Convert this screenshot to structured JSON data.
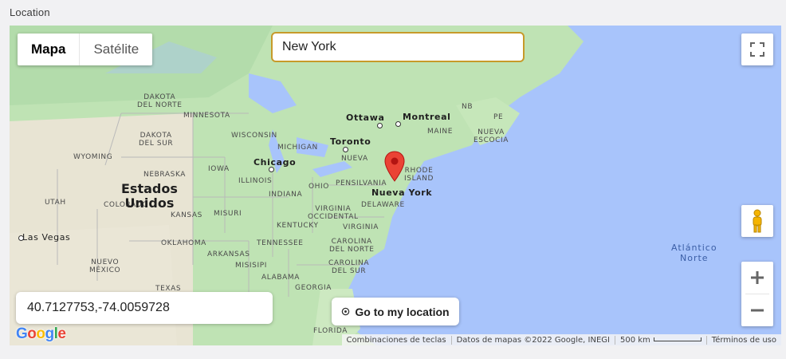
{
  "field": {
    "label": "Location"
  },
  "map_type": {
    "map_label": "Mapa",
    "satellite_label": "Satélite"
  },
  "search": {
    "value": "New York"
  },
  "coords": {
    "value": "40.7127753,-74.0059728"
  },
  "goto": {
    "label": "Go to my location",
    "icon": "location-target-icon"
  },
  "labels": {
    "dakota_norte": "DAKOTA\nDEL NORTE",
    "minnesota": "MINNESOTA",
    "wisconsin": "WISCONSIN",
    "michigan": "MICHIGAN",
    "dakota_sur": "DAKOTA\nDEL SUR",
    "wyoming": "WYOMING",
    "nebraska": "NEBRASKA",
    "iowa": "IOWA",
    "illinois": "ILLINOIS",
    "indiana": "INDIANA",
    "ohio": "OHIO",
    "pensilvania": "PENSILVANIA",
    "nueva_york_state": "NUEVA",
    "utah": "UTAH",
    "colorado": "COLORADO",
    "kansas": "KANSAS",
    "misuri": "MISURI",
    "virginia_occidental": "VIRGINIA\nOCCIDENTAL",
    "virginia": "VIRGINIA",
    "kentucky": "KENTUCKY",
    "delaware": "DELAWARE",
    "oklahoma": "OKLAHOMA",
    "tennessee": "TENNESSEE",
    "carolina_norte": "CAROLINA\nDEL NORTE",
    "carolina_sur": "CAROLINA\nDEL SUR",
    "arkansas": "ARKANSAS",
    "misisipi": "MISISIPI",
    "alabama": "ALABAMA",
    "georgia": "GEORGIA",
    "nuevo_mexico": "NUEVO\nMÉXICO",
    "texas": "TEXAS",
    "florida": "FLORIDA",
    "rhode_island": "RHODE\nISLAND",
    "maine": "MAINE",
    "nb": "NB",
    "pe": "PE",
    "nueva_escocia": "NUEVA\nESCOCIA",
    "ottawa": "Ottawa",
    "montreal": "Montreal",
    "toronto": "Toronto",
    "chicago": "Chicago",
    "nueva_york": "Nueva York",
    "las_vegas": "Las Vegas",
    "estados_unidos": "Estados\nUnidos",
    "atlantico": "Atlántico\nNorte"
  },
  "google_logo": "Google",
  "attribution": {
    "shortcuts": "Combinaciones de teclas",
    "data": "Datos de mapas ©2022 Google, INEGI",
    "scale": "500 km",
    "terms": "Términos de uso"
  },
  "colors": {
    "ocean": "#a8c4fb",
    "land": "#cde9c1",
    "marker": "#ea4335",
    "search_border": "#c79a2a"
  }
}
